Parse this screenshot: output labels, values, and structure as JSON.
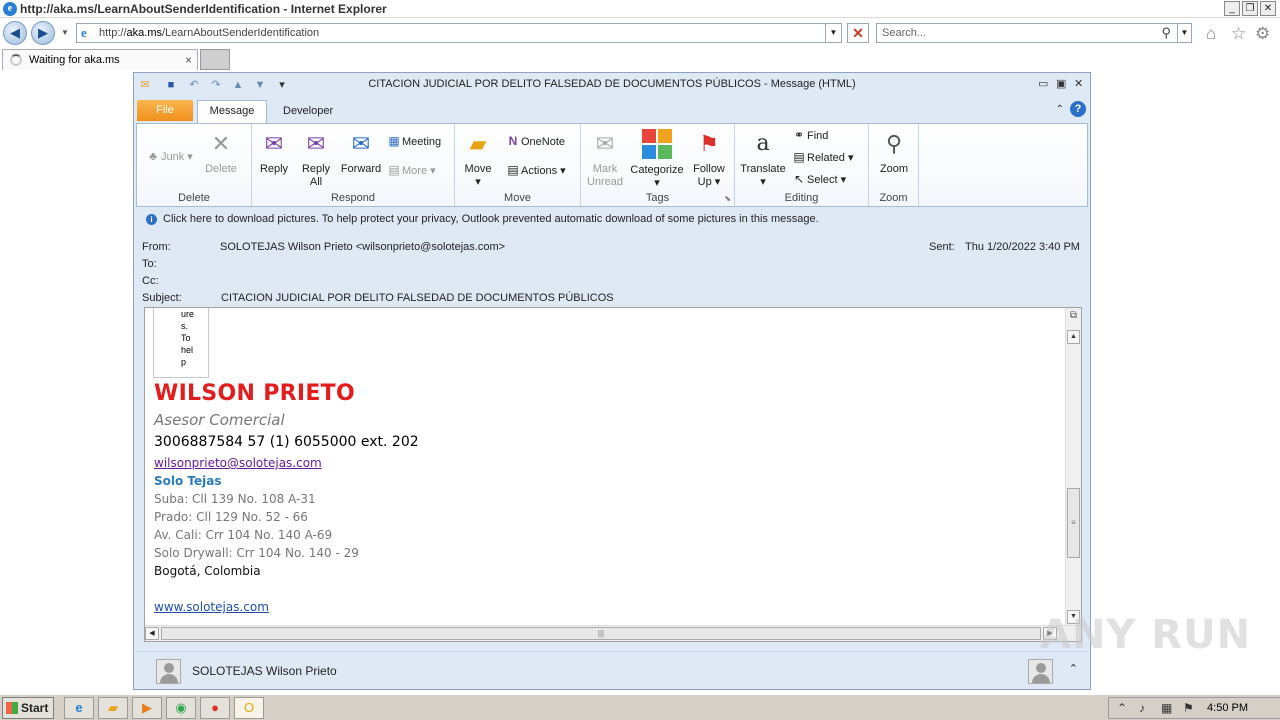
{
  "browser": {
    "window_title": "http://aka.ms/LearnAboutSenderIdentification - Internet Explorer",
    "url_prefix": "http://",
    "url_host": "aka.ms",
    "url_path": "/LearnAboutSenderIdentification",
    "search_placeholder": "Search...",
    "tab_label": "Waiting for aka.ms"
  },
  "outlook": {
    "window_title": "CITACION JUDICIAL POR DELITO FALSEDAD DE DOCUMENTOS PÚBLICOS  -  Message (HTML)",
    "tabs": {
      "file": "File",
      "message": "Message",
      "developer": "Developer"
    },
    "ribbon": {
      "delete_group": {
        "label": "Delete",
        "junk": "Junk",
        "delete": "Delete"
      },
      "respond_group": {
        "label": "Respond",
        "reply": "Reply",
        "reply_all_1": "Reply",
        "reply_all_2": "All",
        "forward": "Forward",
        "meeting": "Meeting",
        "more": "More"
      },
      "move_group": {
        "label": "Move",
        "move": "Move",
        "onenote": "OneNote",
        "actions": "Actions"
      },
      "tags_group": {
        "label": "Tags",
        "mark_unread_1": "Mark",
        "mark_unread_2": "Unread",
        "categorize": "Categorize",
        "follow_up_1": "Follow",
        "follow_up_2": "Up"
      },
      "editing_group": {
        "label": "Editing",
        "translate": "Translate",
        "find": "Find",
        "related": "Related",
        "select": "Select"
      },
      "zoom_group": {
        "label": "Zoom",
        "zoom": "Zoom"
      }
    },
    "infobar": "Click here to download pictures. To help protect your privacy, Outlook prevented automatic download of some pictures in this message.",
    "headers": {
      "from_label": "From:",
      "from_value": "SOLOTEJAS Wilson Prieto <wilsonprieto@solotejas.com>",
      "to_label": "To:",
      "cc_label": "Cc:",
      "subject_label": "Subject:",
      "subject_value": "CITACION JUDICIAL POR DELITO FALSEDAD DE DOCUMENTOS PÚBLICOS",
      "sent_label": "Sent:",
      "sent_value": "Thu 1/20/2022 3:40 PM"
    },
    "body": {
      "image_placeholder_lines": [
        "ure",
        "s.",
        "To",
        "hel",
        "p"
      ],
      "name": "WILSON PRIETO",
      "role": "Asesor Comercial",
      "phone": "3006887584 57 (1) 6055000 ext. 202",
      "email": "wilsonprieto@solotejas.com",
      "company": "Solo Tejas",
      "addresses": [
        "Suba: Cll 139 No. 108 A-31",
        "Prado: Cll 129 No. 52 - 66",
        "Av. Cali: Crr 104 No. 140 A-69",
        "Solo Drywall: Crr 104 No. 140 - 29"
      ],
      "city": "Bogotá, Colombia",
      "website": "www.solotejas.com"
    },
    "people_pane": {
      "name": "SOLOTEJAS Wilson Prieto"
    }
  },
  "taskbar": {
    "start": "Start",
    "clock": "4:50 PM"
  },
  "watermark": "ANY RUN"
}
